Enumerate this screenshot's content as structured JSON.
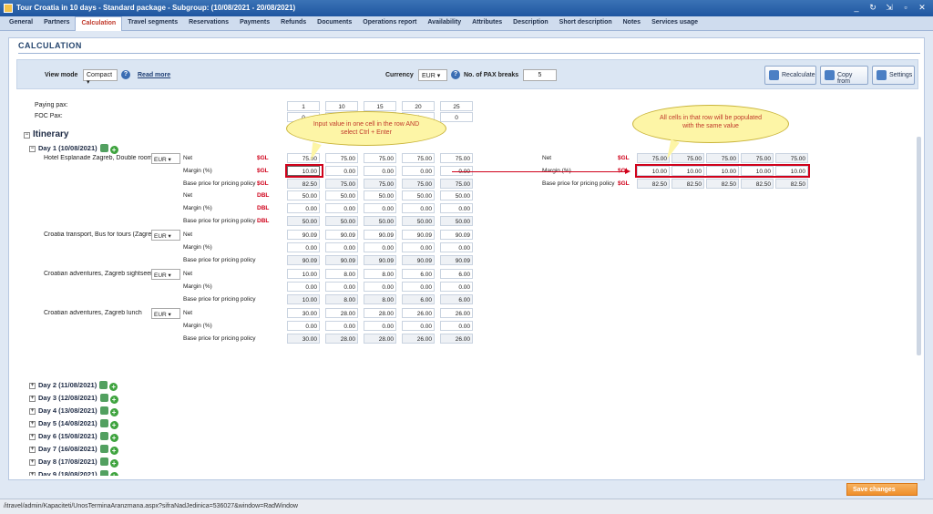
{
  "window": {
    "title": "Tour Croatia in 10 days - Standard package - Subgroup: (10/08/2021 - 20/08/2021)"
  },
  "tabs": [
    "General",
    "Partners",
    "Calculation",
    "Travel segments",
    "Reservations",
    "Payments",
    "Refunds",
    "Documents",
    "Operations report",
    "Availability",
    "Attributes",
    "Description",
    "Short description",
    "Notes",
    "Services usage"
  ],
  "active_tab": "Calculation",
  "section_title": "CALCULATION",
  "toolbar": {
    "view_mode_label": "View mode",
    "view_mode_value": "Compact ▾",
    "read_more": "Read more",
    "currency_label": "Currency",
    "currency_value": "EUR ▾",
    "pax_breaks_label": "No. of PAX breaks",
    "pax_breaks_value": "5",
    "recalculate": "Recalculate",
    "copy_from": "Copy from",
    "settings": "Settings"
  },
  "pax": {
    "paying_label": "Paying pax:",
    "foc_label": "FOC Pax:",
    "paying": [
      "1",
      "10",
      "15",
      "20",
      "25"
    ],
    "foc": [
      "0",
      "0",
      "0",
      "0",
      "0"
    ]
  },
  "itinerary_title": "Itinerary",
  "day1": "Day 1 (10/08/2021)",
  "services": [
    {
      "name": "Hotel Esplanade Zagreb, Double room",
      "currency": "EUR ▾",
      "rows": [
        {
          "label": "Net",
          "type": "$GL",
          "values": [
            "75.00",
            "75.00",
            "75.00",
            "75.00",
            "75.00"
          ]
        },
        {
          "label": "Margin (%)",
          "type": "$GL",
          "values": [
            "10.00",
            "0.00",
            "0.00",
            "0.00",
            "0.00"
          ]
        },
        {
          "label": "Base price for pricing policy",
          "type": "$GL",
          "values": [
            "82.50",
            "75.00",
            "75.00",
            "75.00",
            "75.00"
          ]
        },
        {
          "label": "Net",
          "type": "DBL",
          "values": [
            "50.00",
            "50.00",
            "50.00",
            "50.00",
            "50.00"
          ]
        },
        {
          "label": "Margin (%)",
          "type": "DBL",
          "values": [
            "0.00",
            "0.00",
            "0.00",
            "0.00",
            "0.00"
          ]
        },
        {
          "label": "Base price for pricing policy",
          "type": "DBL",
          "values": [
            "50.00",
            "50.00",
            "50.00",
            "50.00",
            "50.00"
          ]
        }
      ]
    },
    {
      "name": "Croatia transport, Bus for tours (Zagreb)",
      "currency": "EUR ▾",
      "rows": [
        {
          "label": "Net",
          "type": "",
          "values": [
            "90.09",
            "90.09",
            "90.09",
            "90.09",
            "90.09"
          ]
        },
        {
          "label": "Margin (%)",
          "type": "",
          "values": [
            "0.00",
            "0.00",
            "0.00",
            "0.00",
            "0.00"
          ]
        },
        {
          "label": "Base price for pricing policy",
          "type": "",
          "values": [
            "90.09",
            "90.09",
            "90.09",
            "90.09",
            "90.09"
          ]
        }
      ]
    },
    {
      "name": "Croatian adventures, Zagreb sightseeing",
      "currency": "EUR ▾",
      "rows": [
        {
          "label": "Net",
          "type": "",
          "values": [
            "10.00",
            "8.00",
            "8.00",
            "6.00",
            "6.00"
          ]
        },
        {
          "label": "Margin (%)",
          "type": "",
          "values": [
            "0.00",
            "0.00",
            "0.00",
            "0.00",
            "0.00"
          ]
        },
        {
          "label": "Base price for pricing policy",
          "type": "",
          "values": [
            "10.00",
            "8.00",
            "8.00",
            "6.00",
            "6.00"
          ]
        }
      ]
    },
    {
      "name": "Croatian adventures, Zagreb lunch",
      "currency": "EUR ▾",
      "rows": [
        {
          "label": "Net",
          "type": "",
          "values": [
            "30.00",
            "28.00",
            "28.00",
            "26.00",
            "26.00"
          ]
        },
        {
          "label": "Margin (%)",
          "type": "",
          "values": [
            "0.00",
            "0.00",
            "0.00",
            "0.00",
            "0.00"
          ]
        },
        {
          "label": "Base price for pricing policy",
          "type": "",
          "values": [
            "30.00",
            "28.00",
            "28.00",
            "26.00",
            "26.00"
          ]
        }
      ]
    }
  ],
  "days": [
    "Day 2 (11/08/2021)",
    "Day 3 (12/08/2021)",
    "Day 4 (13/08/2021)",
    "Day 5 (14/08/2021)",
    "Day 6 (15/08/2021)",
    "Day 7 (16/08/2021)",
    "Day 8 (17/08/2021)",
    "Day 9 (18/08/2021)",
    "Day 10 (19/08/2021)",
    "Day 11 (20/08/2021)"
  ],
  "result": {
    "rows": [
      {
        "label": "Net",
        "type": "$GL",
        "values": [
          "75.00",
          "75.00",
          "75.00",
          "75.00",
          "75.00"
        ]
      },
      {
        "label": "Margin (%)",
        "type": "$GL",
        "values": [
          "10.00",
          "10.00",
          "10.00",
          "10.00",
          "10.00"
        ]
      },
      {
        "label": "Base price for pricing policy",
        "type": "$GL",
        "values": [
          "82.50",
          "82.50",
          "82.50",
          "82.50",
          "82.50"
        ]
      }
    ]
  },
  "callouts": {
    "left": "Input value in one cell in the row AND select Ctrl + Enter",
    "right": "All cells in that row will be populated with the same value"
  },
  "status_url": "/itravel/admin/Kapaciteti/UnosTerminaAranzmana.aspx?sifraNadJedinica=536027&window=RadWindow",
  "save_button": "Save changes"
}
